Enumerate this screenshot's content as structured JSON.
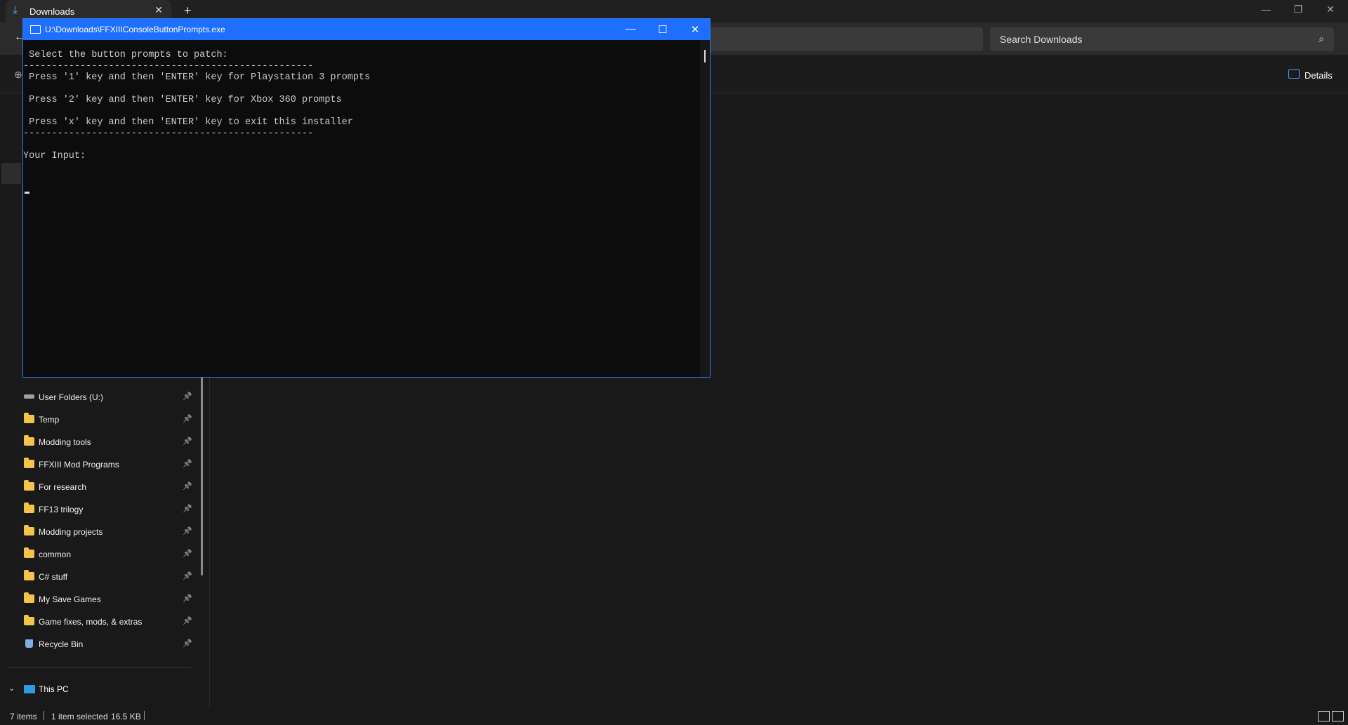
{
  "explorer": {
    "tab_title": "Downloads",
    "new_tab": "+",
    "search_placeholder": "Search Downloads",
    "details_label": "Details",
    "sidebar_items": [
      {
        "label": "User Folders (U:)",
        "icon": "drive-icon"
      },
      {
        "label": "Temp",
        "icon": "folder-icon"
      },
      {
        "label": "Modding tools",
        "icon": "folder-icon"
      },
      {
        "label": "FFXIII Mod Programs",
        "icon": "folder-icon"
      },
      {
        "label": "For research",
        "icon": "folder-icon"
      },
      {
        "label": "FF13 trilogy",
        "icon": "folder-icon"
      },
      {
        "label": "Modding projects",
        "icon": "folder-icon"
      },
      {
        "label": "common",
        "icon": "folder-icon"
      },
      {
        "label": "C# stuff",
        "icon": "folder-icon"
      },
      {
        "label": "My Save Games",
        "icon": "folder-icon"
      },
      {
        "label": "Game fixes, mods, & extras",
        "icon": "folder-icon"
      },
      {
        "label": "Recycle Bin",
        "icon": "recycle-bin-icon"
      }
    ],
    "this_pc": "This PC",
    "status": {
      "items": "7 items",
      "selected": "1 item selected",
      "size": "16.5 KB"
    }
  },
  "console": {
    "title": "U:\\Downloads\\FFXIIIConsoleButtonPrompts.exe",
    "lines": [
      " Select the button prompts to patch:",
      "---------------------------------------------------",
      " Press '1' key and then 'ENTER' key for Playstation 3 prompts",
      " Press '2' key and then 'ENTER' key for Xbox 360 prompts",
      " Press 'x' key and then 'ENTER' key to exit this installer",
      "---------------------------------------------------",
      "Your Input:"
    ]
  },
  "colors": {
    "accent": "#1f6fff",
    "folder": "#f5c24a",
    "background": "#191919",
    "console_bg": "#0c0c0c"
  }
}
